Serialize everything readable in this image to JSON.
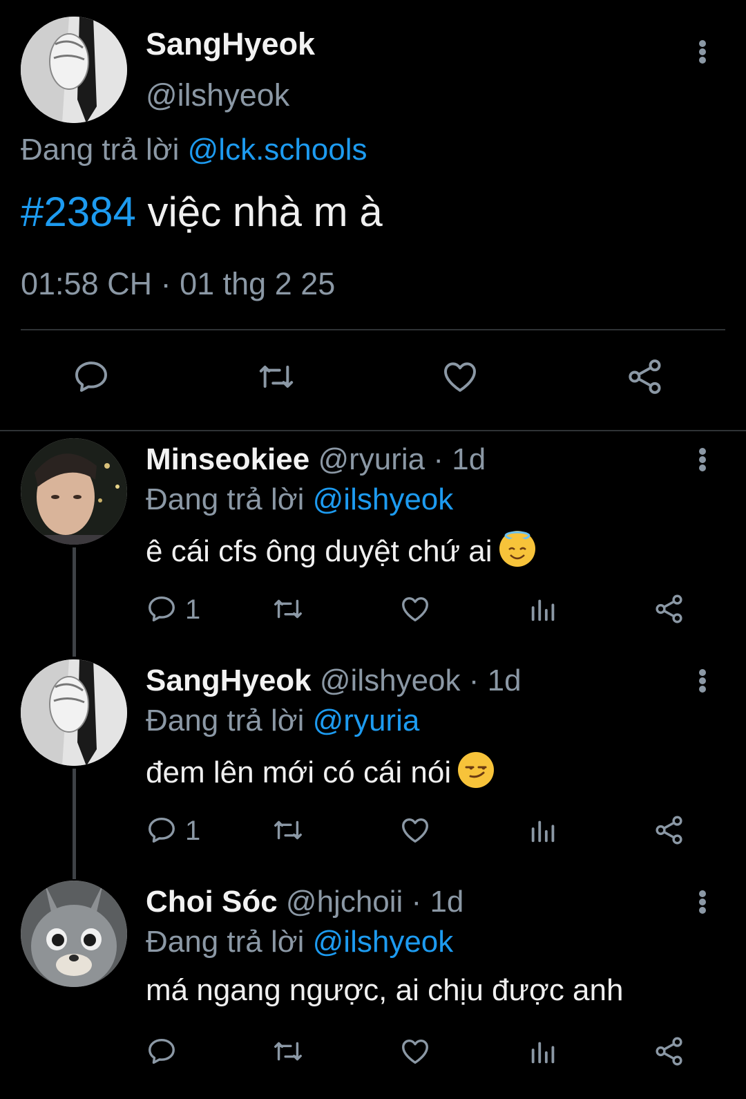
{
  "main": {
    "display_name": "SangHyeok",
    "handle": "@ilshyeok",
    "replying_prefix": "Đang trả lời",
    "replying_to": "@lck.schools",
    "hashtag": "#2384",
    "text": " việc nhà m à",
    "timestamp": "01:58 CH · 01 thg 2 25",
    "actions": [
      "reply-icon",
      "retweet-icon",
      "like-icon",
      "share-icon"
    ]
  },
  "replies": [
    {
      "display_name": "Minseokiee",
      "handle": "@ryuria",
      "time": "1d",
      "replying_prefix": "Đang trả lời",
      "replying_to": "@ilshyeok",
      "text": "ê cái cfs ông duyệt chứ ai",
      "emoji": "smiling-face-with-halo",
      "reply_count": "1"
    },
    {
      "display_name": "SangHyeok",
      "handle": "@ilshyeok",
      "time": "1d",
      "replying_prefix": "Đang trả lời",
      "replying_to": "@ryuria",
      "text": "đem lên mới có cái nói",
      "emoji": "smirking-face",
      "reply_count": "1"
    },
    {
      "display_name": "Choi Sóc",
      "handle": "@hjchoii",
      "time": "1d",
      "replying_prefix": "Đang trả lời",
      "replying_to": "@ilshyeok",
      "text": "má ngang ngược, ai chịu được anh",
      "reply_count": ""
    }
  ],
  "colors": {
    "background": "#000000",
    "accent": "#1d9bf0",
    "secondary_text": "#8b98a5",
    "divider": "#2f3336"
  }
}
